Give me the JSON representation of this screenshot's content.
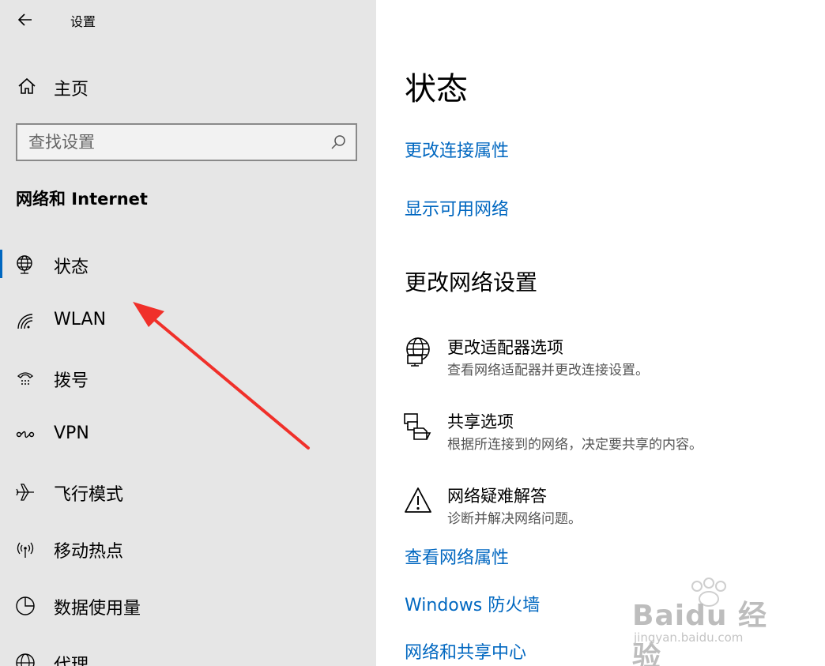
{
  "titlebar": {
    "title": "设置",
    "back_icon": "arrow-left-icon"
  },
  "sidebar": {
    "home_label": "主页",
    "search_placeholder": "查找设置",
    "section_heading": "网络和 Internet",
    "items": [
      {
        "label": "状态",
        "icon": "globe-icon",
        "active": true
      },
      {
        "label": "WLAN",
        "icon": "wifi-icon"
      },
      {
        "label": "拨号",
        "icon": "phone-dial-icon"
      },
      {
        "label": "VPN",
        "icon": "vpn-icon"
      },
      {
        "label": "飞行模式",
        "icon": "airplane-icon"
      },
      {
        "label": "移动热点",
        "icon": "hotspot-icon"
      },
      {
        "label": "数据使用量",
        "icon": "pie-icon"
      },
      {
        "label": "代理",
        "icon": "globe-icon"
      }
    ]
  },
  "main": {
    "title": "状态",
    "links_top": [
      "更改连接属性",
      "显示可用网络"
    ],
    "change_heading": "更改网络设置",
    "options": [
      {
        "title": "更改适配器选项",
        "desc": "查看网络适配器并更改连接设置。",
        "icon": "adapter-globe-icon"
      },
      {
        "title": "共享选项",
        "desc": "根据所连接到的网络，决定要共享的内容。",
        "icon": "sharing-icon"
      },
      {
        "title": "网络疑难解答",
        "desc": "诊断并解决网络问题。",
        "icon": "warning-icon"
      }
    ],
    "links_bottom": [
      "查看网络属性",
      "Windows 防火墙",
      "网络和共享中心"
    ]
  },
  "watermark": {
    "brand": "Baidu 经验",
    "url": "jingyan.baidu.com"
  },
  "colors": {
    "sidebar_bg": "#e6e6e6",
    "accent": "#0067c0",
    "annotation_arrow": "#f0302a"
  }
}
